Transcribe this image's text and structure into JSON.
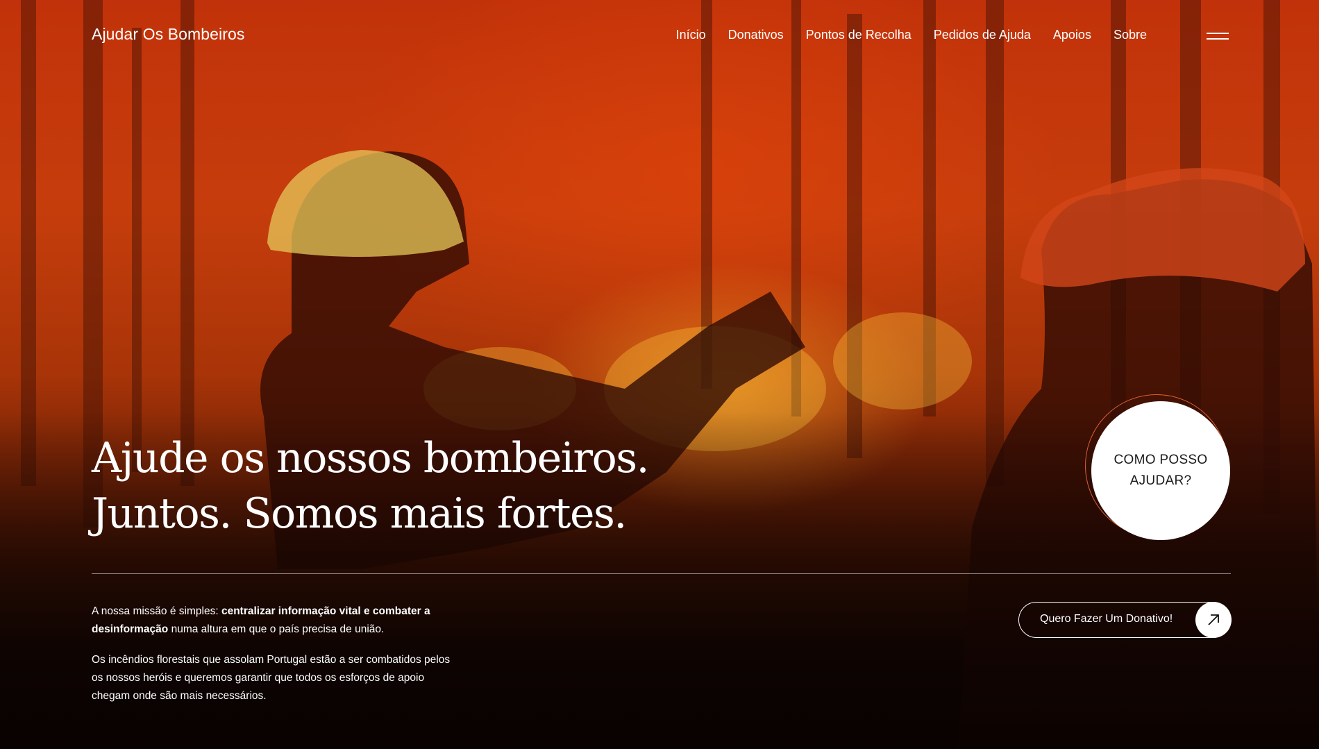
{
  "brand": {
    "name": "Ajudar Os Bombeiros"
  },
  "nav": {
    "items": [
      {
        "label": "Início"
      },
      {
        "label": "Donativos"
      },
      {
        "label": "Pontos de Recolha"
      },
      {
        "label": "Pedidos de Ajuda"
      },
      {
        "label": "Apoios"
      },
      {
        "label": "Sobre"
      }
    ],
    "menu_icon": "hamburger-icon"
  },
  "hero": {
    "headline_line1": "Ajude os nossos bombeiros.",
    "headline_line2": "Juntos. Somos mais fortes.",
    "circle_cta": "COMO POSSO AJUDAR?",
    "mission_intro": "A nossa missão é simples: ",
    "mission_bold": "centralizar informação vital e combater a desinformação",
    "mission_end": " numa altura em que o país precisa de união.",
    "mission_p2": "Os incêndios florestais que assolam Portugal estão a ser combatidos pelos os nossos heróis e queremos garantir que todos os esforços de apoio chegam onde são mais necessários.",
    "donate_label": "Quero Fazer Um Donativo!",
    "donate_icon": "arrow-up-right-icon"
  },
  "colors": {
    "accent_ring": "#f06e3c",
    "background_fire": "#c2320a"
  }
}
